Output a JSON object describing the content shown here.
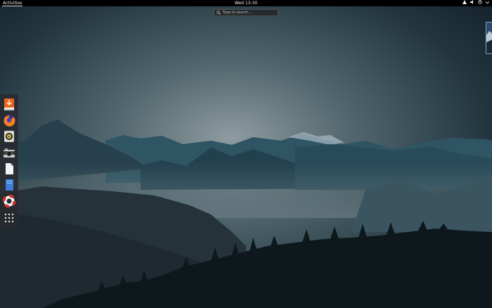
{
  "topbar": {
    "activities_label": "Activities",
    "clock": "Wed 13:30",
    "tray_icons": [
      "network-icon",
      "volume-icon",
      "power-icon",
      "chevron-down-icon"
    ]
  },
  "search": {
    "placeholder": "Type to search…"
  },
  "dash": {
    "items": [
      {
        "name": "software-icon",
        "label": "Software"
      },
      {
        "name": "firefox-icon"
      },
      {
        "name": "rhythmbox-icon"
      },
      {
        "name": "camera-icon"
      },
      {
        "name": "document-icon"
      },
      {
        "name": "notes-icon"
      },
      {
        "name": "help-icon"
      },
      {
        "name": "app-grid-icon"
      }
    ]
  },
  "colors": {
    "topbar": "#000000",
    "dash": "#2a2c2f",
    "sky": "#4a5e66"
  }
}
